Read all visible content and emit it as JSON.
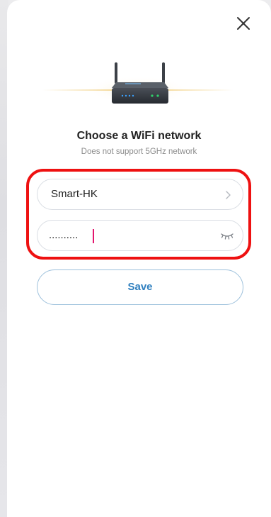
{
  "dialog": {
    "title": "Choose a WiFi network",
    "subtitle": "Does not support 5GHz network"
  },
  "ssid_field": {
    "value": "Smart-HK",
    "icon": "chevron-right-icon"
  },
  "password_field": {
    "value": "..........",
    "visibility_icon": "eye-closed-icon"
  },
  "save_button": {
    "label": "Save"
  },
  "close_button": {
    "icon": "close-icon"
  },
  "colors": {
    "accent": "#2f7fbf",
    "highlight_annotation": "#ee1111",
    "caret": "#e3166e",
    "router_led_blue": "#3aa0ff",
    "router_led_green": "#2fd16a",
    "glow": "#f2d38a"
  }
}
